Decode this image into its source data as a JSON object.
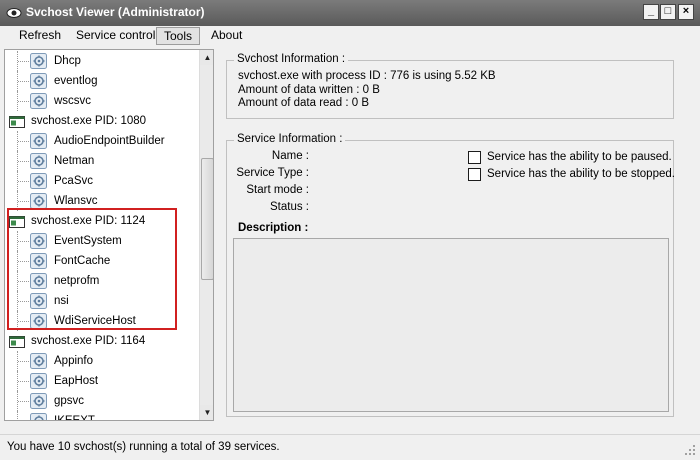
{
  "window": {
    "title": "Svchost Viewer (Administrator)"
  },
  "menu": [
    "Refresh",
    "Service control",
    "Tools",
    "About"
  ],
  "tree": [
    {
      "type": "service",
      "label": "Dhcp"
    },
    {
      "type": "service",
      "label": "eventlog"
    },
    {
      "type": "service",
      "label": "wscsvc"
    },
    {
      "type": "host",
      "label": "svchost.exe PID: 1080"
    },
    {
      "type": "service",
      "label": "AudioEndpointBuilder"
    },
    {
      "type": "service",
      "label": "Netman"
    },
    {
      "type": "service",
      "label": "PcaSvc"
    },
    {
      "type": "service",
      "label": "Wlansvc"
    },
    {
      "type": "host",
      "label": "svchost.exe PID: 1124"
    },
    {
      "type": "service",
      "label": "EventSystem"
    },
    {
      "type": "service",
      "label": "FontCache"
    },
    {
      "type": "service",
      "label": "netprofm"
    },
    {
      "type": "service",
      "label": "nsi"
    },
    {
      "type": "service",
      "label": "WdiServiceHost"
    },
    {
      "type": "host",
      "label": "svchost.exe PID: 1164"
    },
    {
      "type": "service",
      "label": "Appinfo"
    },
    {
      "type": "service",
      "label": "EapHost"
    },
    {
      "type": "service",
      "label": "gpsvc"
    },
    {
      "type": "service",
      "label": "IKEEXT"
    }
  ],
  "svchost_info": {
    "legend": "Svchost Information :",
    "memory_line": "svchost.exe with process ID : 776 is using 5.52 KB",
    "written_line": "Amount of data written : 0 B",
    "read_line": "Amount of data read : 0 B"
  },
  "service_info": {
    "legend": "Service Information :",
    "name_label": "Name :",
    "type_label": "Service Type :",
    "start_label": "Start mode :",
    "status_label": "Status :",
    "pause_checkbox": "Service has the ability to be paused.",
    "stop_checkbox": "Service has the ability to be stopped.",
    "description_label": "Description :"
  },
  "status_bar": {
    "text": "You have 10 svchost(s) running a total of 39 services."
  },
  "colors": {
    "highlight": "#d12020",
    "titlebar": "#6a6a6a"
  }
}
